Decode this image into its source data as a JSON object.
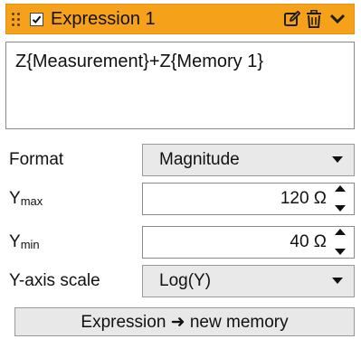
{
  "header": {
    "title": "Expression 1",
    "enabled": true,
    "background_color": "#f5a21a",
    "icons": [
      "drag-handle-icon",
      "checkbox-checked-icon",
      "edit-icon",
      "trash-icon",
      "chevron-down-icon"
    ]
  },
  "expression": {
    "text": "Z{Measurement}+Z{Memory 1}"
  },
  "format": {
    "label": "Format",
    "selected": "Magnitude"
  },
  "ymax": {
    "label_main": "Y",
    "label_sub": "max",
    "value": "120 Ω"
  },
  "ymin": {
    "label_main": "Y",
    "label_sub": "min",
    "value": "40 Ω"
  },
  "yaxis_scale": {
    "label": "Y-axis scale",
    "selected": "Log(Y)"
  },
  "actions": {
    "to_memory_label": "Expression ➜ new memory"
  }
}
